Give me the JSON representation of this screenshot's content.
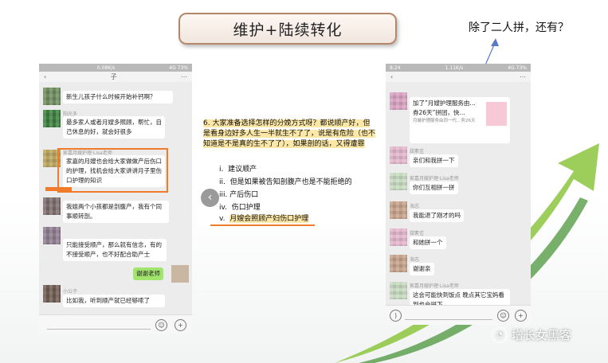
{
  "slide": {
    "title": "维护+陆续转化",
    "note": "除了二人拼，还有？",
    "watermark": "增长女黑客"
  },
  "left_phone": {
    "status": {
      "left": "",
      "center": "0.08K/s",
      "right": "4G 73%"
    },
    "nav_title": "子",
    "messages": [
      {
        "text": "新生儿孩子什么时候开始补钙啊？",
        "sender": ""
      },
      {
        "text": "最多家人或者月嫂多照顾，帮忙，自己休息的好，就会好很多",
        "sender": "阳光多"
      },
      {
        "text": "家嘉的月嫂也会给大家做做产后伤口的护理，找机会给大家讲讲月子里伤口护理的知识",
        "sender": "家嘉月嫂护理·Lisa老师"
      },
      {
        "text": "我姐两个小孩都是剖腹产，我有个同事顺转剖。",
        "sender": ""
      },
      {
        "text": "只能接受顺产，那么就有信念，有的不接受顺产，也不好配合助产士",
        "sender": ""
      },
      {
        "text": "谢谢老师",
        "sender": ""
      },
      {
        "text": "比如我，听到顺产就已经够嗦了",
        "sender": "小公子"
      }
    ]
  },
  "doc": {
    "question": "6. 大家准备选择怎样的分娩方式呀？都说顺产好，但是看身边好多人生一半就生不了了，说是有危险（也不知道是不是真的生不了了），如果剖的话，又得遭罪",
    "options": [
      {
        "num": "i.",
        "text": "建议顺产"
      },
      {
        "num": "ii.",
        "text": "但是如果被告知剖腹产也是不能拒绝的"
      },
      {
        "num": "iii.",
        "text": "产后伤口"
      },
      {
        "num": "iv.",
        "text": "伤口护理"
      },
      {
        "num": "v.",
        "text": "月嫂会照顾产妇伤口护理"
      }
    ]
  },
  "right_phone": {
    "status": {
      "left": "8:24",
      "center": "1.11K/s",
      "right": "4G 73%"
    },
    "card_text": "加了”月嫂护理服务由…券26天”拼团，快…",
    "card_sub": "月嫂护理服务由同一代…务26天",
    "messages": [
      {
        "text": "亲们和我拼一下",
        "sender": "甜素佳"
      },
      {
        "text": "你们互相拼一拼",
        "sender": "家嘉月嫂护理·Lisa老师"
      },
      {
        "text": "我能退了刚才的吗",
        "sender": "海志"
      },
      {
        "text": "和她拼一个",
        "sender": "甜素佳"
      },
      {
        "text": "谢谢亲",
        "sender": "海志"
      },
      {
        "text": "这会可能快到饭点 晚点其它宝妈看到也会拼下",
        "sender": "家嘉月嫂护理·Lisa老师"
      }
    ]
  },
  "colors": {
    "highlight": "#f07c2b",
    "bubble_green": "#a1e56e"
  }
}
